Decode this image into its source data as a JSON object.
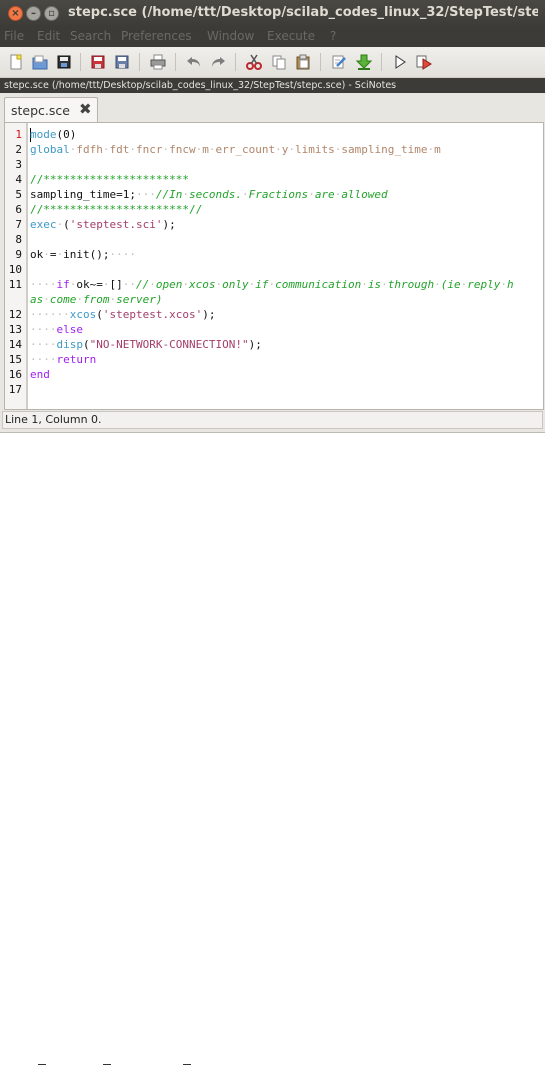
{
  "window": {
    "title": "stepc.sce (/home/ttt/Desktop/scilab_codes_linux_32/StepTest/stepc.sce) - SciNotes"
  },
  "menu": [
    "File",
    "Edit",
    "Search",
    "Preferences",
    "Window",
    "Execute",
    "?"
  ],
  "toolbar": {
    "icons": [
      "new-file-icon",
      "open-file-icon",
      "open-folder-icon",
      "save-icon",
      "save-as-icon",
      "print-icon",
      "undo-icon",
      "redo-icon",
      "cut-icon",
      "copy-icon",
      "paste-icon",
      "comment-icon",
      "load-into-scilab-icon",
      "execute-icon",
      "execute-with-echo-icon"
    ]
  },
  "pathbar": {
    "text": "stepc.sce (/home/ttt/Desktop/scilab_codes_linux_32/StepTest/stepc.sce) - SciNotes"
  },
  "tab": {
    "label": "stepc.sce",
    "close_symbol": "✖"
  },
  "editor": {
    "line_numbers": [
      "1",
      "2",
      "3",
      "4",
      "5",
      "6",
      "7",
      "8",
      "9",
      "10",
      "11",
      "",
      "12",
      "13",
      "14",
      "15",
      "16",
      "17"
    ],
    "active_line": "1"
  },
  "status": {
    "text": "Line 1, Column 0."
  },
  "colors": {
    "keyword": "#a020f0",
    "function": "#3e9ac6",
    "comment": "#23a32b",
    "string": "#a33e6a",
    "titlebar": "#3c3b37"
  }
}
